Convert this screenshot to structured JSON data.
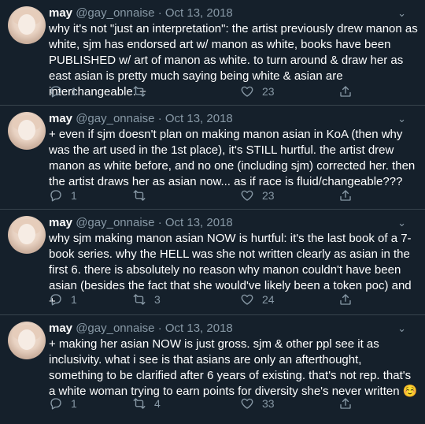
{
  "tweets": [
    {
      "name": "may",
      "handle": "@gay_onnaise",
      "dot": "·",
      "date": "Oct 13, 2018",
      "text": "why it's not \"just an interpretation\": the artist previously drew manon as white, sjm has endorsed art w/ manon as white, books have been PUBLISHED w/ art of manon as white. to turn around & draw her as east asian is pretty much saying being white & asian are interchangeable. +",
      "replies": "1",
      "retweets": "",
      "likes": "23"
    },
    {
      "name": "may",
      "handle": "@gay_onnaise",
      "dot": "·",
      "date": "Oct 13, 2018",
      "text": "+ even if sjm doesn't plan on making manon asian in KoA (then why was the art used in the 1st place), it's STILL hurtful. the artist drew manon as white before, and no one (including sjm) corrected her. then the artist draws her as asian now... as if race is fluid/changeable???",
      "replies": "1",
      "retweets": "",
      "likes": "23"
    },
    {
      "name": "may",
      "handle": "@gay_onnaise",
      "dot": "·",
      "date": "Oct 13, 2018",
      "text": "why sjm making manon asian NOW is hurtful: it's the last book of a 7-book series. why the HELL was she not written clearly as asian in the first 6. there is absolutely no reason why manon couldn't have been asian (besides the fact that she would've likely been a token poc) and +",
      "replies": "1",
      "retweets": "3",
      "likes": "24"
    },
    {
      "name": "may",
      "handle": "@gay_onnaise",
      "dot": "·",
      "date": "Oct 13, 2018",
      "text": "+ making her asian NOW is just gross. sjm & other ppl see it as inclusivity. what i see is that asians are only an afterthought, something to be clarified after 6 years of existing. that's not rep. that's a white woman trying to earn points for diversity she's never written ☺️",
      "replies": "1",
      "retweets": "4",
      "likes": "33"
    }
  ],
  "icons": {
    "caret": "chevron-down-icon",
    "reply": "reply-icon",
    "retweet": "retweet-icon",
    "like": "heart-icon",
    "share": "share-icon"
  },
  "colors": {
    "background": "#15202b",
    "secondary_text": "#8899a6",
    "divider": "#38444d"
  }
}
